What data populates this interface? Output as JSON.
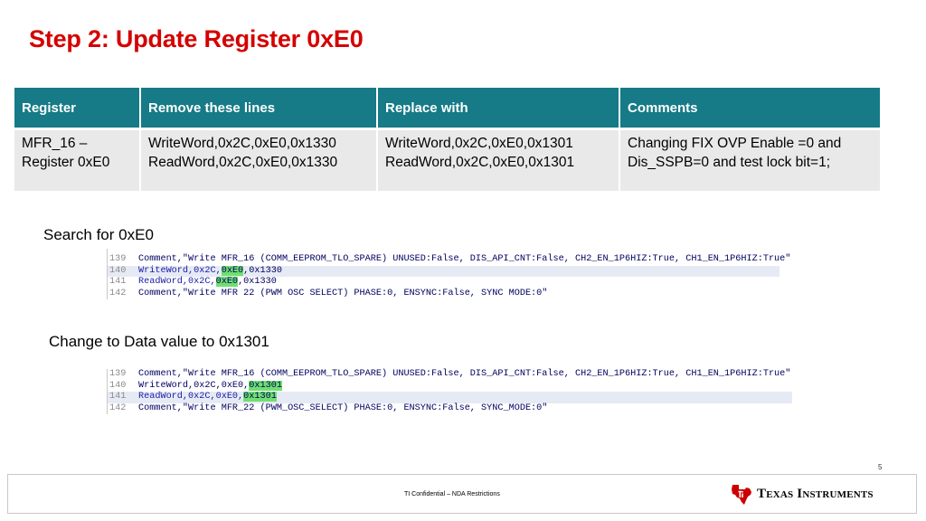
{
  "slide": {
    "title": "Step 2: Update Register 0xE0",
    "page_number": "5",
    "footer_text": "TI Confidential – NDA Restrictions",
    "logo_text_line": "Texas Instruments",
    "title_color": "#d50000",
    "header_color": "#167a87"
  },
  "table": {
    "headers": [
      "Register",
      "Remove these lines",
      "Replace with",
      "Comments"
    ],
    "row": {
      "register": [
        "MFR_16 –",
        "Register 0xE0"
      ],
      "remove": [
        "WriteWord,0x2C,0xE0,0x1330",
        "ReadWord,0x2C,0xE0,0x1330"
      ],
      "replace": [
        "WriteWord,0x2C,0xE0,0x1301",
        "ReadWord,0x2C,0xE0,0x1301"
      ],
      "comments": [
        "Changing FIX OVP Enable =0 and",
        "Dis_SSPB=0  and  test lock bit=1;"
      ]
    }
  },
  "search": {
    "caption": "Search for 0xE0",
    "lines": [
      {
        "num": "139",
        "pre": "Comment,\"Write MFR_16 (COMM_EEPROM_TLO_SPARE) UNUSED:False, DIS_API_CNT:False, CH2_EN_1P6HIZ:True, CH1_EN_1P6HIZ:True\"",
        "hit": "",
        "post": ""
      },
      {
        "num": "140",
        "pre": "WriteWord,0x2C,",
        "hit": "0xE0",
        "post": ",0x1330"
      },
      {
        "num": "141",
        "pre": "ReadWord,0x2C,",
        "hit": "0xE0",
        "post": ",0x1330"
      },
      {
        "num": "142",
        "pre": "Comment,\"Write MFR 22 (PWM OSC SELECT) PHASE:0, ENSYNC:False, SYNC MODE:0\"",
        "hit": "",
        "post": ""
      }
    ]
  },
  "change": {
    "caption": "Change to Data value to 0x1301",
    "lines": [
      {
        "num": "139",
        "pre": "Comment,\"Write MFR_16 (COMM_EEPROM_TLO_SPARE) UNUSED:False, DIS_API_CNT:False, CH2_EN_1P6HIZ:True, CH1_EN_1P6HIZ:True\"",
        "hit": "",
        "post": ""
      },
      {
        "num": "140",
        "pre": "WriteWord,0x2C,0xE0,",
        "hit": "0x1301",
        "post": ""
      },
      {
        "num": "141",
        "pre": "ReadWord,0x2C,0xE0,",
        "hit": "0x1301",
        "post": ""
      },
      {
        "num": "142",
        "pre": "Comment,\"Write MFR_22 (PWM_OSC_SELECT) PHASE:0, ENSYNC:False, SYNC_MODE:0\"",
        "hit": "",
        "post": ""
      }
    ]
  }
}
